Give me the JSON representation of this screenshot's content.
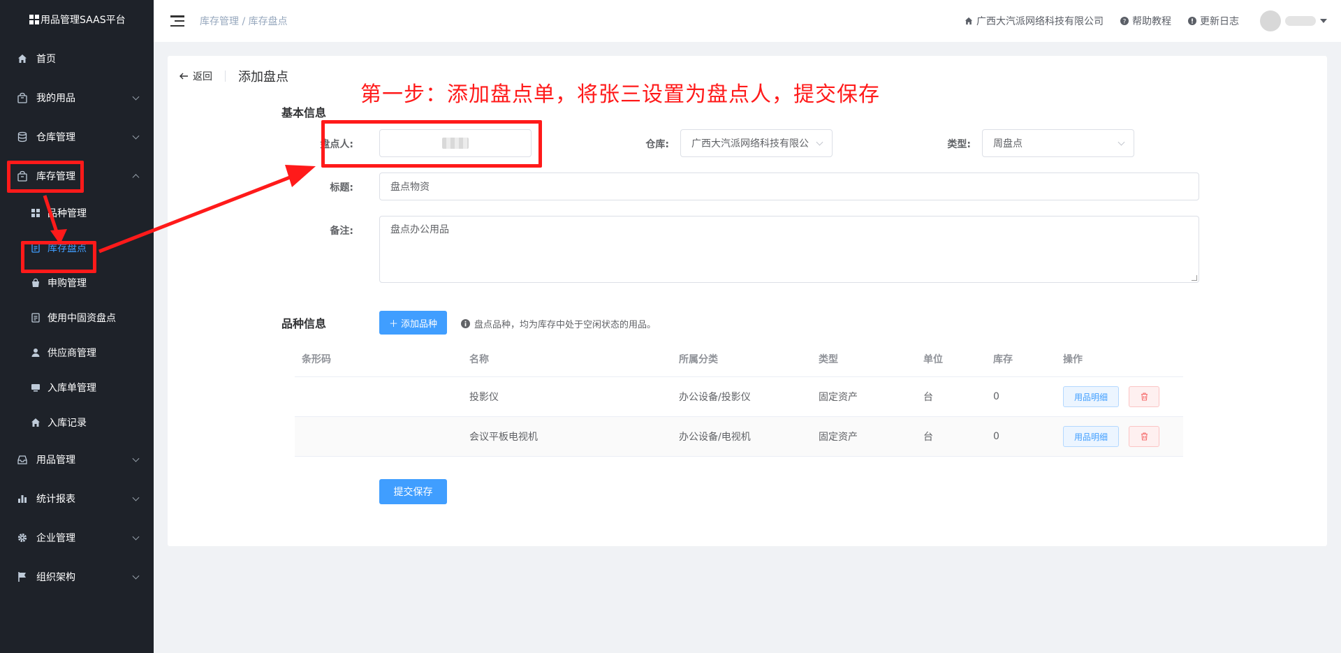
{
  "brand": {
    "title": "用品管理SAAS平台"
  },
  "sidebar": {
    "items": [
      {
        "label": "首页",
        "icon": "home-icon"
      },
      {
        "label": "我的用品",
        "icon": "bag-icon"
      },
      {
        "label": "仓库管理",
        "icon": "database-icon"
      },
      {
        "label": "库存管理",
        "icon": "box-icon"
      },
      {
        "label": "用品管理",
        "icon": "inbox-icon"
      },
      {
        "label": "统计报表",
        "icon": "bar-chart-icon"
      },
      {
        "label": "企业管理",
        "icon": "gear-icon"
      },
      {
        "label": "组织架构",
        "icon": "flag-icon"
      }
    ],
    "inventory_sub": [
      {
        "label": "品种管理",
        "icon": "grid-icon"
      },
      {
        "label": "库存盘点",
        "icon": "document-icon"
      },
      {
        "label": "申购管理",
        "icon": "shopping-bag-icon"
      },
      {
        "label": "使用中固资盘点",
        "icon": "document-icon"
      },
      {
        "label": "供应商管理",
        "icon": "user-icon"
      },
      {
        "label": "入库单管理",
        "icon": "monitor-icon"
      },
      {
        "label": "入库记录",
        "icon": "home-icon"
      }
    ]
  },
  "header": {
    "breadcrumb_parent": "库存管理",
    "breadcrumb_sep": "/",
    "breadcrumb_current": "库存盘点",
    "company": "广西大汽派网络科技有限公司",
    "help": "帮助教程",
    "changelog": "更新日志"
  },
  "page": {
    "back_label": "返回",
    "title": "添加盘点",
    "annotation": "第一步：添加盘点单，将张三设置为盘点人，提交保存"
  },
  "basic_info": {
    "section_title": "基本信息",
    "checker_label": "盘点人:",
    "warehouse_label": "仓库:",
    "warehouse_value": "广西大汽派网络科技有限公",
    "type_label": "类型:",
    "type_value": "周盘点",
    "title_label": "标题:",
    "title_value": "盘点物资",
    "remark_label": "备注:",
    "remark_value": "盘点办公用品"
  },
  "variety_info": {
    "section_title": "品种信息",
    "add_button": "添加品种",
    "hint": "盘点品种，均为库存中处于空闲状态的用品。",
    "columns": [
      "条形码",
      "名称",
      "所属分类",
      "类型",
      "单位",
      "库存",
      "操作"
    ],
    "rows": [
      {
        "barcode": "",
        "name": "投影仪",
        "category": "办公设备/投影仪",
        "type": "固定资产",
        "unit": "台",
        "stock": "0"
      },
      {
        "barcode": "",
        "name": "会议平板电视机",
        "category": "办公设备/电视机",
        "type": "固定资产",
        "unit": "台",
        "stock": "0"
      }
    ],
    "detail_button": "用品明细"
  },
  "submit_button": "提交保存",
  "colors": {
    "primary": "#409eff",
    "annotation": "#ff1a1a",
    "sidebar_bg": "#1e2229"
  }
}
